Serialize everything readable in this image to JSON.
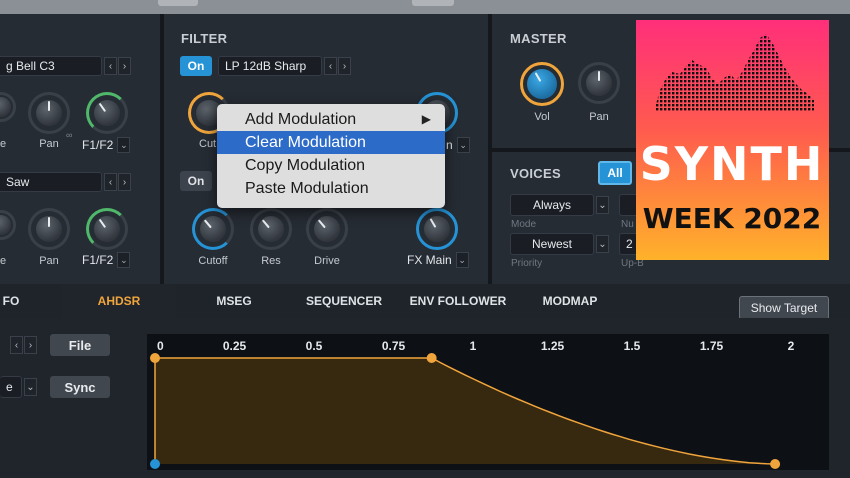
{
  "osc1": {
    "preset": "g Bell C3",
    "knob_left_label": "e",
    "pan_label": "Pan",
    "output": "F1/F2"
  },
  "osc2": {
    "preset": "Saw",
    "knob_left_label": "e",
    "pan_label": "Pan",
    "output": "F1/F2"
  },
  "filter": {
    "title": "FILTER",
    "toggle": "On",
    "type": "LP 12dB Sharp",
    "cutoff_label_partial": "Cut",
    "right_label_partial": "n",
    "toggle2": "On",
    "cutoff_label": "Cutoff",
    "res_label": "Res",
    "drive_label": "Drive",
    "fx_dest": "FX Main"
  },
  "master": {
    "title": "MASTER",
    "vol_label": "Vol",
    "pan_label": "Pan"
  },
  "voices": {
    "title": "VOICES",
    "all_btn": "All",
    "mode_value": "Always",
    "mode_label": "Mode",
    "num_label": "Nu",
    "priority_value": "Newest",
    "priority_label": "Priority",
    "upbend_value": "2",
    "upbend_label": "Up-B"
  },
  "context_menu": {
    "items": [
      {
        "label": "Add Modulation",
        "submenu": "▶"
      },
      {
        "label": "Clear Modulation"
      },
      {
        "label": "Copy Modulation"
      },
      {
        "label": "Paste Modulation"
      }
    ]
  },
  "tabs": [
    "FO",
    "AHDSR",
    "MSEG",
    "SEQUENCER",
    "ENV FOLLOWER",
    "MODMAP"
  ],
  "active_tab": "AHDSR",
  "show_target": "Show Target",
  "left_controls": {
    "file_btn": "File",
    "mode_partial": "e",
    "sync_btn": "Sync"
  },
  "envelope": {
    "axis_labels": [
      "0",
      "0.25",
      "0.5",
      "0.75",
      "1",
      "1.25",
      "1.5",
      "1.75",
      "2"
    ],
    "points": [
      {
        "x": 0,
        "y": 0
      },
      {
        "x": 0,
        "y": 1
      },
      {
        "x": 0.87,
        "y": 1
      },
      {
        "x": 1.95,
        "y": 0
      }
    ],
    "x_range": [
      0,
      2
    ],
    "fill_color": "#3a2a10",
    "line_color": "#f0a53c"
  },
  "badge": {
    "line1": "SYNTH",
    "line2": "WEEK 2022"
  },
  "colors": {
    "accent_blue": "#2593d6",
    "accent_orange": "#f0a53c",
    "accent_green": "#4fb86a",
    "menu_highlight": "#2d6bc9"
  }
}
